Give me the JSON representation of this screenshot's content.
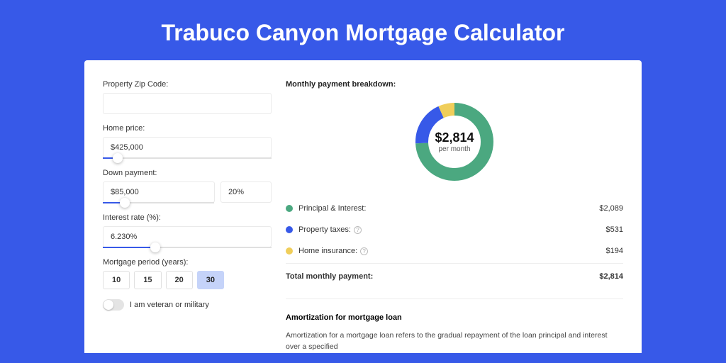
{
  "title": "Trabuco Canyon Mortgage Calculator",
  "colors": {
    "principal": "#4ba880",
    "taxes": "#3759e8",
    "insurance": "#f0ce5a"
  },
  "form": {
    "zip": {
      "label": "Property Zip Code:",
      "value": ""
    },
    "home_price": {
      "label": "Home price:",
      "value": "$425,000",
      "slider_pct": 9
    },
    "down_payment": {
      "label": "Down payment:",
      "amount": "$85,000",
      "percent": "20%",
      "slider_pct": 20
    },
    "interest": {
      "label": "Interest rate (%):",
      "value": "6.230%",
      "slider_pct": 31
    },
    "period": {
      "label": "Mortgage period (years):",
      "options": [
        "10",
        "15",
        "20",
        "30"
      ],
      "selected": "30"
    },
    "veteran": {
      "label": "I am veteran or military",
      "on": false
    }
  },
  "breakdown": {
    "header": "Monthly payment breakdown:",
    "donut_amount": "$2,814",
    "donut_sub": "per month",
    "items": [
      {
        "key": "principal",
        "label": "Principal & Interest:",
        "value": "$2,089",
        "info": false,
        "pct": 74.2
      },
      {
        "key": "taxes",
        "label": "Property taxes:",
        "value": "$531",
        "info": true,
        "pct": 18.9
      },
      {
        "key": "insurance",
        "label": "Home insurance:",
        "value": "$194",
        "info": true,
        "pct": 6.9
      }
    ],
    "total_label": "Total monthly payment:",
    "total_value": "$2,814"
  },
  "amortization": {
    "title": "Amortization for mortgage loan",
    "text": "Amortization for a mortgage loan refers to the gradual repayment of the loan principal and interest over a specified"
  }
}
